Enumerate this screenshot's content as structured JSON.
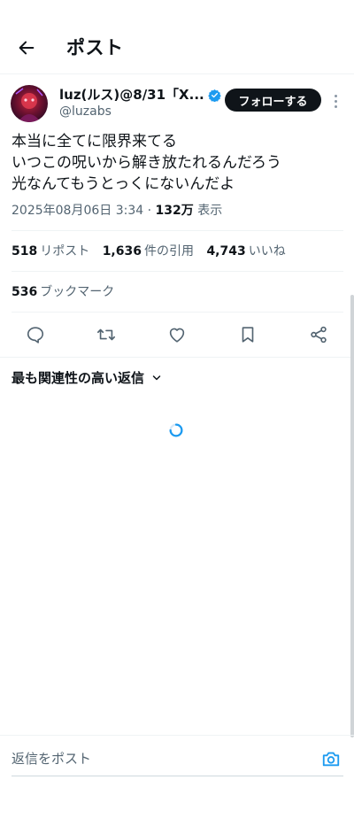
{
  "header": {
    "title": "ポスト"
  },
  "post": {
    "author": {
      "name": "luz(ルス)@8/31「X...",
      "handle": "@luzabs",
      "verified": true
    },
    "follow_label": "フォローする",
    "text_lines": [
      "本当に全てに限界来てる",
      "いつこの呪いから解き放たれるんだろう",
      "光なんてもうとっくにないんだよ"
    ],
    "timestamp": "2025年08月06日 3:34",
    "separator": " · ",
    "views_count": "132万",
    "views_label": " 表示",
    "stats": {
      "reposts_count": "518",
      "reposts_label": "リポスト",
      "quotes_count": "1,636",
      "quotes_label": "件の引用",
      "likes_count": "4,743",
      "likes_label": "いいね",
      "bookmarks_count": "536",
      "bookmarks_label": "ブックマーク"
    }
  },
  "actions": [
    "reply-icon",
    "repost-icon",
    "like-icon",
    "bookmark-icon",
    "share-icon"
  ],
  "replies": {
    "sort_label": "最も関連性の高い返信"
  },
  "composer": {
    "placeholder": "返信をポスト"
  },
  "colors": {
    "text_primary": "#0f1419",
    "text_secondary": "#536471",
    "accent": "#1d9bf0",
    "button_bg": "#0f1419"
  }
}
